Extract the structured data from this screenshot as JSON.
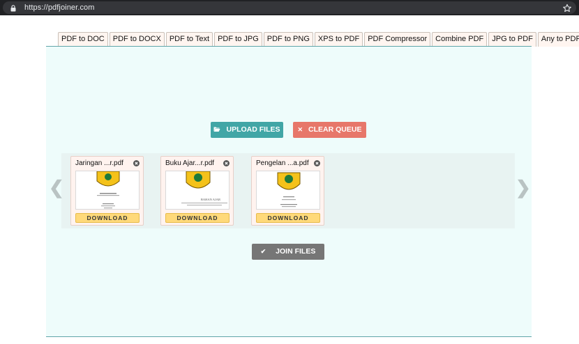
{
  "browser": {
    "url": "https://pdfjoiner.com"
  },
  "tabs": [
    {
      "label": "PDF to DOC"
    },
    {
      "label": "PDF to DOCX"
    },
    {
      "label": "PDF to Text"
    },
    {
      "label": "PDF to JPG"
    },
    {
      "label": "PDF to PNG"
    },
    {
      "label": "XPS to PDF"
    },
    {
      "label": "PDF Compressor"
    },
    {
      "label": "Combine PDF"
    },
    {
      "label": "JPG to PDF"
    },
    {
      "label": "Any to PDF"
    }
  ],
  "actions": {
    "upload_label": "UPLOAD FILES",
    "clear_label": "CLEAR QUEUE",
    "join_label": "JOIN FILES"
  },
  "files": [
    {
      "name": "Jaringan ...r.pdf",
      "download_label": "DOWNLOAD",
      "thumb_title": ""
    },
    {
      "name": "Buku Ajar...r.pdf",
      "download_label": "DOWNLOAD",
      "thumb_title": "BAHAN AJAR"
    },
    {
      "name": "Pengelan ...a.pdf",
      "download_label": "DOWNLOAD",
      "thumb_title": ""
    }
  ],
  "colors": {
    "upload": "#41a6a6",
    "clear": "#e7776a",
    "join": "#767676",
    "download": "#ffd97a",
    "panel": "#eefcfb"
  },
  "icons": {
    "address_bar": [
      "lock-icon",
      "star-icon"
    ],
    "upload": "folder-open-icon",
    "clear": "close-icon",
    "join": "check-icon",
    "carousel": [
      "chevron-left-icon",
      "chevron-right-icon"
    ]
  }
}
